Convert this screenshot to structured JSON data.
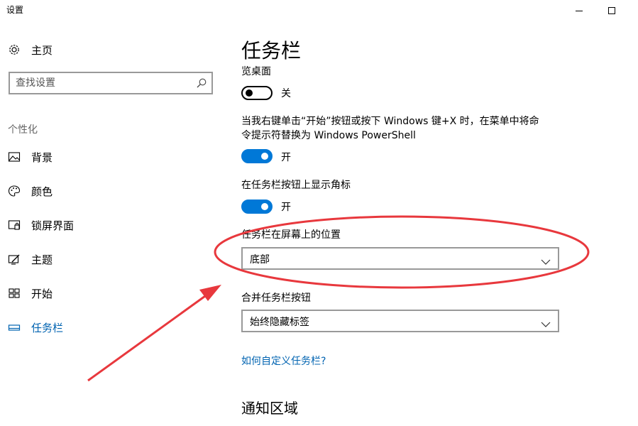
{
  "window": {
    "title": "设置",
    "minimize_icon": "minimize-icon",
    "maximize_icon": "maximize-icon"
  },
  "sidebar": {
    "home": {
      "label": "主页",
      "icon": "gear-icon"
    },
    "search": {
      "placeholder": "查找设置",
      "value": "",
      "icon": "search-icon"
    },
    "group_label": "个性化",
    "items": [
      {
        "label": "背景",
        "icon": "picture-icon",
        "active": false
      },
      {
        "label": "颜色",
        "icon": "palette-icon",
        "active": false
      },
      {
        "label": "锁屏界面",
        "icon": "lock-screen-icon",
        "active": false
      },
      {
        "label": "主题",
        "icon": "theme-icon",
        "active": false
      },
      {
        "label": "开始",
        "icon": "start-icon",
        "active": false
      },
      {
        "label": "任务栏",
        "icon": "taskbar-icon",
        "active": true
      }
    ],
    "accent_color": "#0063b1"
  },
  "main": {
    "title": "任务栏",
    "peek": {
      "label": "览桌面",
      "state": "关",
      "on": false
    },
    "powershell": {
      "line1": "当我右键单击“开始”按钮或按下 Windows 键+X 时，在菜单中将命",
      "line2": "令提示符替换为 Windows PowerShell",
      "state": "开",
      "on": true
    },
    "badges": {
      "label": "在任务栏按钮上显示角标",
      "state": "开",
      "on": true
    },
    "location": {
      "label": "任务栏在屏幕上的位置",
      "value": "底部"
    },
    "combine": {
      "label": "合并任务栏按钮",
      "value": "始终隐藏标签"
    },
    "help_link": "如何自定义任务栏?",
    "notification_section": "通知区域",
    "toggle_on_color": "#0078d7"
  },
  "annotation": {
    "color": "#e8383d"
  }
}
